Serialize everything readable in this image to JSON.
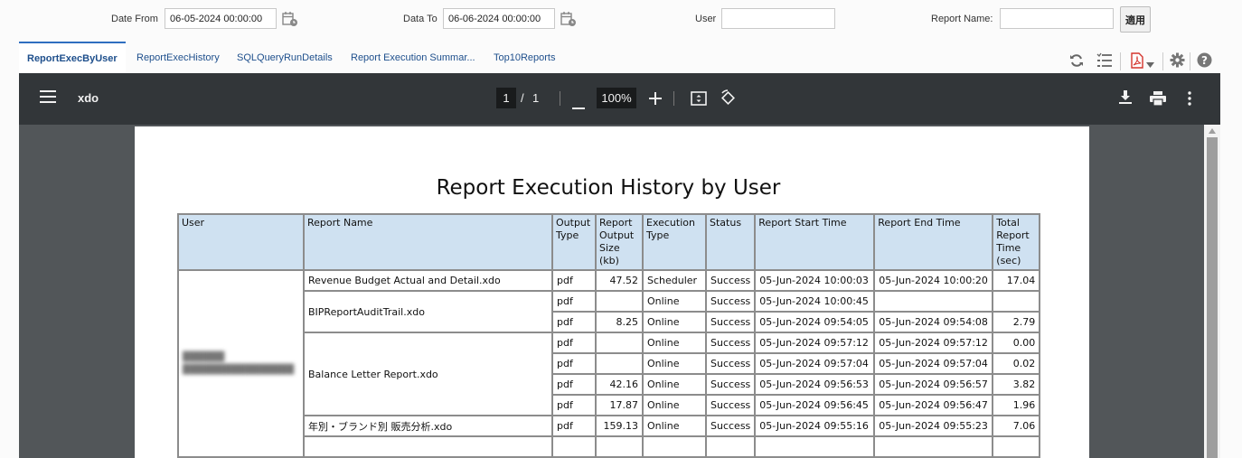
{
  "params": {
    "date_from_label": "Date From",
    "date_from_value": "06-05-2024 00:00:00",
    "date_to_label": "Data To",
    "date_to_value": "06-06-2024 00:00:00",
    "user_label": "User",
    "user_value": "",
    "report_name_label": "Report Name:",
    "report_name_value": "",
    "apply_label": "適用"
  },
  "tabs": [
    {
      "label": "ReportExecByUser",
      "active": true
    },
    {
      "label": "ReportExecHistory"
    },
    {
      "label": "SQLQueryRunDetails"
    },
    {
      "label": "Report Execution Summar..."
    },
    {
      "label": "Top10Reports"
    }
  ],
  "toolbar_icons": [
    "refresh-icon",
    "list-icon",
    "pdf-icon",
    "dropdown-arrow-icon",
    "settings-icon",
    "help-icon"
  ],
  "viewer": {
    "title": "xdo",
    "current_page": "1",
    "page_sep": "/",
    "total_pages": "1",
    "zoom": "100%",
    "icons": [
      "menu-icon",
      "zoom-out-icon",
      "zoom-in-icon",
      "fit-page-icon",
      "rotate-icon",
      "download-icon",
      "print-icon",
      "more-icon"
    ]
  },
  "report": {
    "title": "Report Execution History by User",
    "headers": {
      "user": "User",
      "report_name": "Report Name",
      "output_type": "Output Type",
      "output_size": "Report Output Size (kb)",
      "exec_type": "Execution Type",
      "status": "Status",
      "start": "Report Start Time",
      "end": "Report End Time",
      "total": "Total Report Time (sec)"
    },
    "user_blurred": "(redacted)",
    "reports": [
      {
        "name": "Revenue Budget Actual and Detail.xdo"
      },
      {
        "name": "BIPReportAuditTrail.xdo"
      },
      {
        "name": "Balance Letter Report.xdo"
      },
      {
        "name": "年別・ブランド別 販売分析.xdo"
      }
    ],
    "rows": [
      {
        "out": "pdf",
        "size": "47.52",
        "exec": "Scheduler",
        "status": "Success",
        "start": "05-Jun-2024 10:00:03",
        "end": "05-Jun-2024 10:00:20",
        "total": "17.04"
      },
      {
        "out": "pdf",
        "size": "",
        "exec": "Online",
        "status": "Success",
        "start": "05-Jun-2024 10:00:45",
        "end": "",
        "total": ""
      },
      {
        "out": "pdf",
        "size": "8.25",
        "exec": "Online",
        "status": "Success",
        "start": "05-Jun-2024 09:54:05",
        "end": "05-Jun-2024 09:54:08",
        "total": "2.79"
      },
      {
        "out": "pdf",
        "size": "",
        "exec": "Online",
        "status": "Success",
        "start": "05-Jun-2024 09:57:12",
        "end": "05-Jun-2024 09:57:12",
        "total": "0.00"
      },
      {
        "out": "pdf",
        "size": "",
        "exec": "Online",
        "status": "Success",
        "start": "05-Jun-2024 09:57:04",
        "end": "05-Jun-2024 09:57:04",
        "total": "0.02"
      },
      {
        "out": "pdf",
        "size": "42.16",
        "exec": "Online",
        "status": "Success",
        "start": "05-Jun-2024 09:56:53",
        "end": "05-Jun-2024 09:56:57",
        "total": "3.82"
      },
      {
        "out": "pdf",
        "size": "17.87",
        "exec": "Online",
        "status": "Success",
        "start": "05-Jun-2024 09:56:45",
        "end": "05-Jun-2024 09:56:47",
        "total": "1.96"
      },
      {
        "out": "pdf",
        "size": "159.13",
        "exec": "Online",
        "status": "Success",
        "start": "05-Jun-2024 09:55:16",
        "end": "05-Jun-2024 09:55:23",
        "total": "7.06"
      }
    ]
  }
}
